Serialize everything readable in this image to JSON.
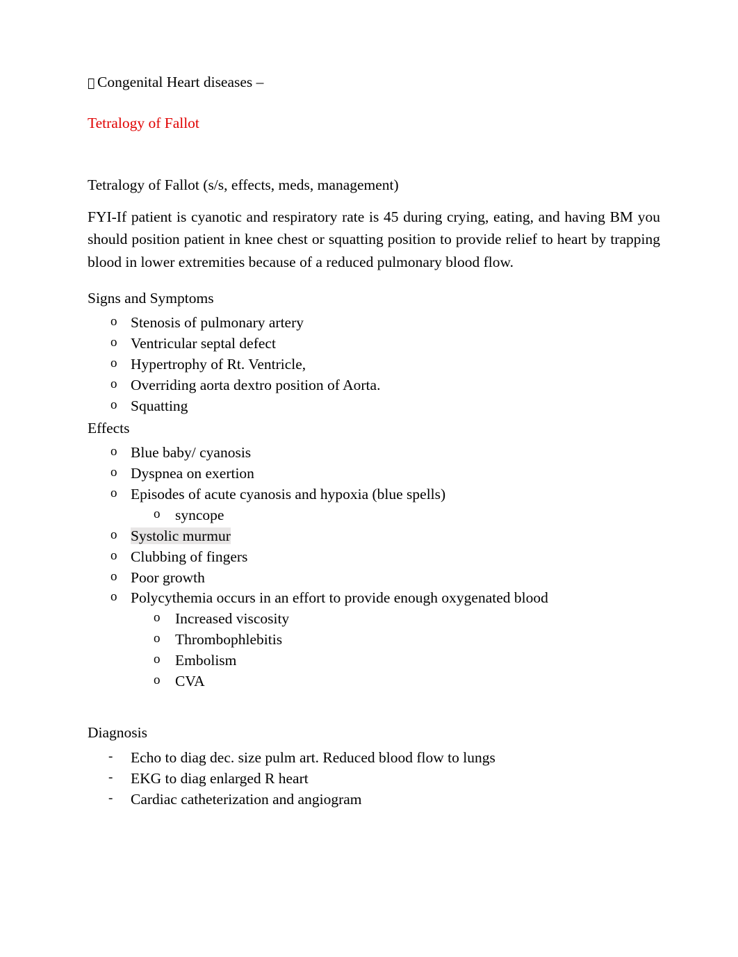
{
  "document": {
    "heading": {
      "bullet": "",
      "text": "Congenital Heart diseases –"
    },
    "title": "Tetralogy of Fallot",
    "subtitle": "Tetralogy of Fallot (s/s, effects, meds, management)",
    "fyi_paragraph": "FYI-If patient is cyanotic and respiratory rate is 45 during crying, eating, and having BM you should position patient in knee chest or squatting position to provide relief to heart by trapping blood in lower extremities because of a reduced pulmonary blood flow.",
    "sections": [
      {
        "label": "Signs and Symptoms",
        "marker": "o",
        "items": [
          {
            "text": "Stenosis of pulmonary artery"
          },
          {
            "text": "Ventricular septal defect"
          },
          {
            "text": "Hypertrophy of Rt. Ventricle,"
          },
          {
            "text": "Overriding aorta dextro position of Aorta."
          },
          {
            "text": "Squatting"
          }
        ]
      },
      {
        "label": "Effects",
        "marker": "o",
        "items": [
          {
            "text": "Blue baby/ cyanosis"
          },
          {
            "text": "Dyspnea on exertion"
          },
          {
            "text": "Episodes of acute cyanosis and hypoxia (blue spells)",
            "sub": [
              "syncope"
            ]
          },
          {
            "text": "Systolic murmur",
            "highlight": true
          },
          {
            "text": "Clubbing of fingers"
          },
          {
            "text": "Poor growth"
          },
          {
            "text": "Polycythemia occurs in an effort to provide enough oxygenated blood",
            "sub": [
              "Increased viscosity",
              "Thrombophlebitis",
              "Embolism",
              "CVA"
            ]
          }
        ]
      },
      {
        "label": "Diagnosis",
        "marker": "-",
        "items": [
          {
            "text": "Echo to diag dec. size pulm art. Reduced blood flow to lungs"
          },
          {
            "text": "EKG to diag enlarged R heart"
          },
          {
            "text": "Cardiac catheterization and angiogram"
          }
        ]
      }
    ],
    "colors": {
      "title": "#e00000",
      "highlight": "#e8e6e6",
      "text": "#000000",
      "background": "#ffffff"
    }
  }
}
